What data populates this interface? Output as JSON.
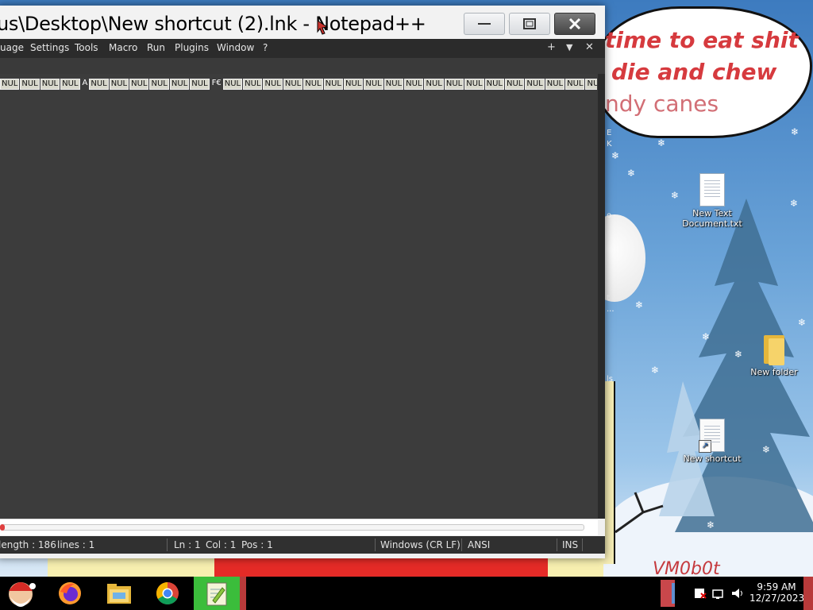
{
  "desktop": {
    "bubble_lines": [
      "time to eat shit",
      "die and chew",
      "ndy canes"
    ],
    "signature": "VM0b0t",
    "peek_letters": [
      {
        "text": "E"
      },
      {
        "text": "K"
      },
      {
        "text": "o"
      },
      {
        "text": "t"
      },
      {
        "text": "..."
      },
      {
        "text": "ls"
      },
      {
        "text": "..."
      },
      {
        "text": "ut"
      }
    ],
    "icons": [
      {
        "label_line1": "New Text",
        "label_line2": "Document.txt",
        "icon": "text-document-icon"
      },
      {
        "label_line1": "New folder",
        "label_line2": "",
        "icon": "folder-icon"
      },
      {
        "label_line1": "New shortcut",
        "label_line2": "",
        "icon": "shortcut-icon"
      }
    ]
  },
  "window": {
    "title": "us\\Desktop\\New shortcut (2).lnk - Notepad++",
    "menu": [
      "uage",
      "Settings",
      "Tools",
      "Macro",
      "Run",
      "Plugins",
      "Window",
      "?"
    ],
    "menu_right": [
      "+",
      "▼",
      "✕"
    ],
    "editor": {
      "tokens": [
        "NUL",
        "NUL",
        "NUL",
        "NUL",
        "Ã",
        "NUL",
        "NUL",
        "NUL",
        "NUL",
        "NUL",
        "NUL",
        "F€",
        "NUL",
        "NUL",
        "NUL",
        "NUL",
        "NUL",
        "NUL",
        "NUL",
        "NUL",
        "NUL",
        "NUL",
        "NUL",
        "NUL",
        "NUL",
        "NUL",
        "NUL",
        "NUL",
        "NUL",
        "NUL",
        "NUL",
        "NUL"
      ]
    },
    "status": {
      "length": "length : 186",
      "lines": "lines : 1",
      "ln": "Ln : 1",
      "col": "Col : 1",
      "pos": "Pos : 1",
      "eol": "Windows (CR LF)",
      "encoding": "ANSI",
      "mode": "INS"
    }
  },
  "taskbar": {
    "apps": [
      {
        "name": "santa-start-icon",
        "active": false
      },
      {
        "name": "firefox-icon",
        "active": false
      },
      {
        "name": "file-explorer-icon",
        "active": false
      },
      {
        "name": "chrome-icon",
        "active": false
      },
      {
        "name": "notepadpp-icon",
        "active": true
      }
    ],
    "time": "9:59 AM",
    "date": "12/27/2023"
  },
  "colors": {
    "accent_active": "#3bbd3b",
    "bubble_text": "#d63a3e",
    "menubar": "#2b2b2b",
    "editor_bg": "#3c3c3c"
  }
}
